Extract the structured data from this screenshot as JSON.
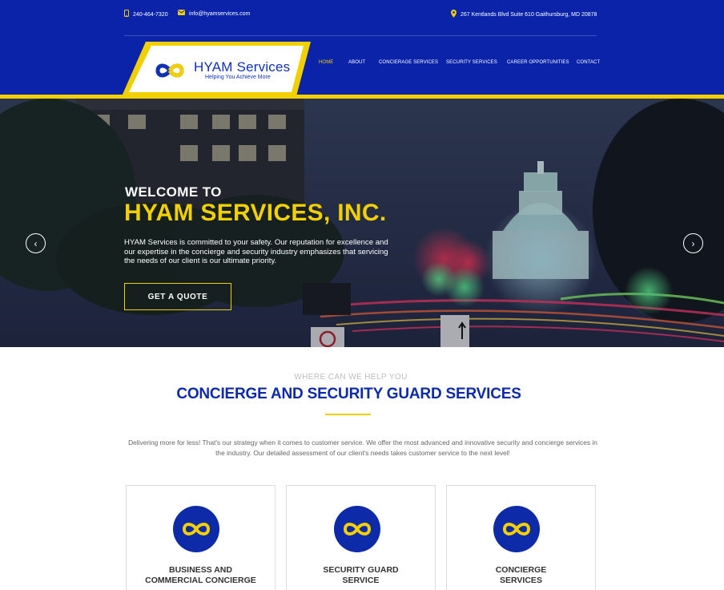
{
  "topbar": {
    "phone": "240-464-7320",
    "email": "info@hyamservices.com",
    "address": "267 Kentlands Blvd Suite 610 Gaithursburg, MD 20878"
  },
  "logo": {
    "name": "HYAM Services",
    "tagline": "Helping You Achieve More"
  },
  "nav": {
    "items": [
      {
        "label": "HOME",
        "active": true
      },
      {
        "label": "ABOUT"
      },
      {
        "label": "CONCIERAGE SERVICES"
      },
      {
        "label": "SECURITY SERVICES"
      },
      {
        "label": "CAREER OPPORTUNITIES"
      },
      {
        "label": "CONTACT"
      }
    ]
  },
  "hero": {
    "welcome": "WELCOME TO",
    "title": "HYAM SERVICES, INC.",
    "text": "HYAM Services is committed to your safety. Our reputation for excellence and our expertise in the concierge and security industry emphasizes that servicing the needs of our client is our ultimate priority.",
    "cta": "GET A QUOTE",
    "prev_glyph": "‹",
    "next_glyph": "›"
  },
  "services": {
    "eyebrow": "WHERE CAN WE HELP YOU",
    "title": "CONCIERGE AND SECURITY GUARD SERVICES",
    "intro": "Delivering more for less! That's our strategy when it comes to customer service. We offer the most advanced and innovative security and concierge services in the industry. Our detailed assessment of our client's needs takes customer service to the next level!",
    "cards": [
      {
        "line1": "BUSINESS AND",
        "line2": "COMMERCIAL CONCIERGE",
        "icon": "infinity-icon"
      },
      {
        "line1": "SECURITY GUARD",
        "line2": "SERVICE",
        "icon": "infinity-icon"
      },
      {
        "line1": "CONCIERGE",
        "line2": "SERVICES",
        "icon": "infinity-icon"
      }
    ]
  },
  "colors": {
    "brand_blue": "#0a23a8",
    "accent_yellow": "#f2d000"
  }
}
